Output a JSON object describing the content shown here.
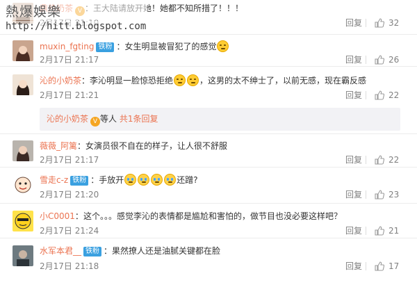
{
  "watermark": {
    "title": "熱爆娛樂",
    "url": "http://hitt.blogspot.com"
  },
  "labels": {
    "reply": "回复",
    "badge_fan": "铁粉"
  },
  "colors": {
    "username": "#eb7350",
    "badge": "#3aa0e0",
    "meta": "#808080",
    "subreply_bg": "#f2f2f5"
  },
  "comments": [
    {
      "username": "鼎热奶茶",
      "text": "王大陆请放开她！她都不知所措了！！！",
      "date": "2月17日 21:10",
      "likes": "32"
    },
    {
      "username": "muxin_fgting",
      "badge": "铁粉",
      "text": "女生明显被冒犯了的感觉",
      "date": "2月17日 21:17",
      "likes": "26"
    },
    {
      "username": "沁的小奶茶",
      "text_a": "李沁明显一脸惊恐拒绝",
      "text_b": "，这男的太不绅士了，以前无感，现在霸反感",
      "date": "2月17日 21:21",
      "likes": "22"
    },
    {
      "username": "薇薇_阿篱",
      "text": "女演员很不自在的样子，让人很不舒服",
      "date": "2月17日 21:17",
      "likes": "22"
    },
    {
      "username": "雪走c-z",
      "badge": "铁粉",
      "text_a": "手放开",
      "text_b": "还蹭?",
      "date": "2月17日 21:20",
      "likes": "23"
    },
    {
      "username": "小C0001",
      "text": "这个。。。感觉李沁的表情都是尴尬和害怕的，做节目也没必要这样吧？",
      "date": "2月17日 21:24",
      "likes": "21"
    },
    {
      "username": "水军本君__",
      "badge": "铁粉",
      "text": "果然撩人还是油腻关键都在脸",
      "date": "2月17日 21:18",
      "likes": "17"
    }
  ],
  "subreply": {
    "username": "沁的小奶茶",
    "people": "等人",
    "more": "共1条回复"
  }
}
